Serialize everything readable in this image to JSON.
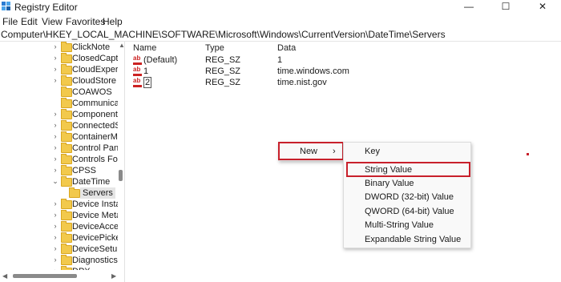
{
  "window": {
    "title": "Registry Editor",
    "minimize_glyph": "—",
    "maximize_glyph": "☐",
    "close_glyph": "✕"
  },
  "menubar": [
    "File",
    "Edit",
    "View",
    "Favorites",
    "Help"
  ],
  "address": "Computer\\HKEY_LOCAL_MACHINE\\SOFTWARE\\Microsoft\\Windows\\CurrentVersion\\DateTime\\Servers",
  "tree": {
    "items": [
      {
        "label": "ClickNote",
        "expander": "›"
      },
      {
        "label": "ClosedCaption",
        "expander": "›"
      },
      {
        "label": "CloudExperier",
        "expander": "›"
      },
      {
        "label": "CloudStore",
        "expander": "›"
      },
      {
        "label": "COAWOS",
        "expander": ""
      },
      {
        "label": "Communicatio",
        "expander": ""
      },
      {
        "label": "Component B",
        "expander": "›"
      },
      {
        "label": "ConnectedSea",
        "expander": "›"
      },
      {
        "label": "ContainerMap",
        "expander": "›"
      },
      {
        "label": "Control Panel",
        "expander": "›"
      },
      {
        "label": "Controls Folde",
        "expander": "›"
      },
      {
        "label": "CPSS",
        "expander": "›"
      },
      {
        "label": "DateTime",
        "expander": "⌄"
      },
      {
        "label": "Servers",
        "expander": ""
      },
      {
        "label": "Device Installe",
        "expander": "›"
      },
      {
        "label": "Device Metad",
        "expander": "›"
      },
      {
        "label": "DeviceAccess",
        "expander": "›"
      },
      {
        "label": "DevicePicker",
        "expander": "›"
      },
      {
        "label": "DeviceSetup",
        "expander": "›"
      },
      {
        "label": "Diagnostics",
        "expander": "›"
      },
      {
        "label": "DPX",
        "expander": "›"
      }
    ]
  },
  "list": {
    "columns": [
      "Name",
      "Type",
      "Data"
    ],
    "rows": [
      {
        "icon": "ab",
        "name": "(Default)",
        "type": "REG_SZ",
        "data": "1"
      },
      {
        "icon": "ab",
        "name": "1",
        "type": "REG_SZ",
        "data": "time.windows.com"
      },
      {
        "icon": "ab",
        "name": "2",
        "type": "REG_SZ",
        "data": "time.nist.gov"
      }
    ]
  },
  "context_menu": {
    "new_label": "New",
    "new_arrow": "›"
  },
  "submenu": {
    "items": [
      "Key",
      "String Value",
      "Binary Value",
      "DWORD (32-bit) Value",
      "QWORD (64-bit) Value",
      "Multi-String Value",
      "Expandable String Value"
    ]
  },
  "colors": {
    "highlight": "#c8202b",
    "folder": "#f2c94c"
  }
}
